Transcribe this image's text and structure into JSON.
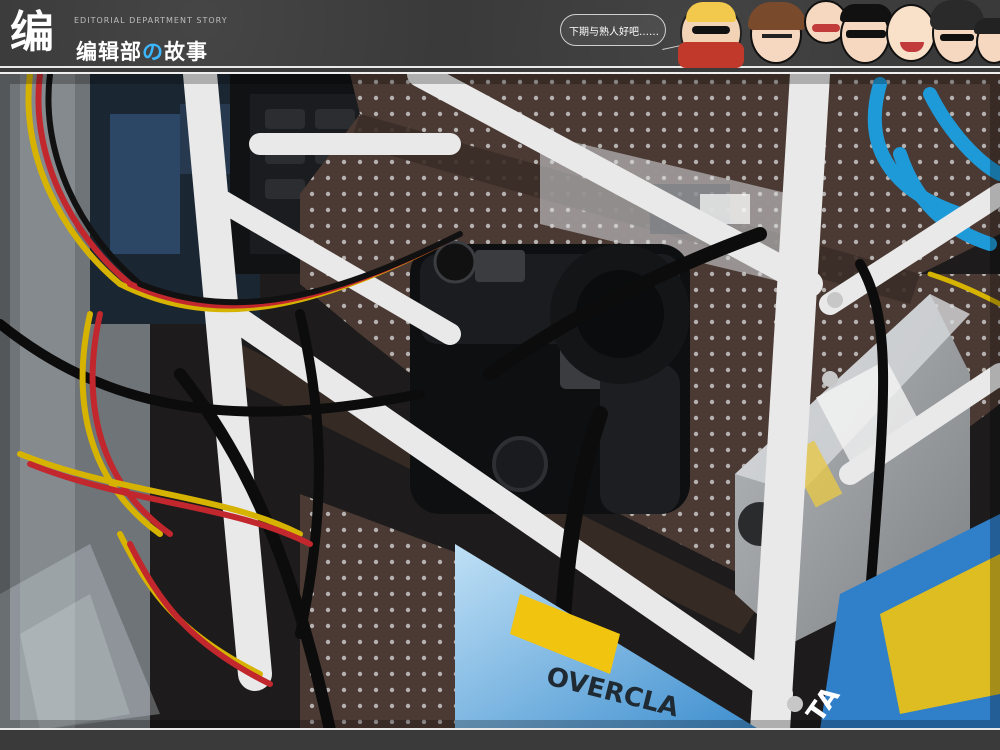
{
  "header": {
    "logo_mark": "编",
    "subtitle": "EDITORIAL DEPARTMENT STORY",
    "title_pre": "编辑部",
    "title_accent": "の",
    "title_post": "故事",
    "speech": "下期与熟人好吧……"
  },
  "photo": {
    "banner_text": "OVERCLA",
    "banner_text_right": "TA"
  }
}
